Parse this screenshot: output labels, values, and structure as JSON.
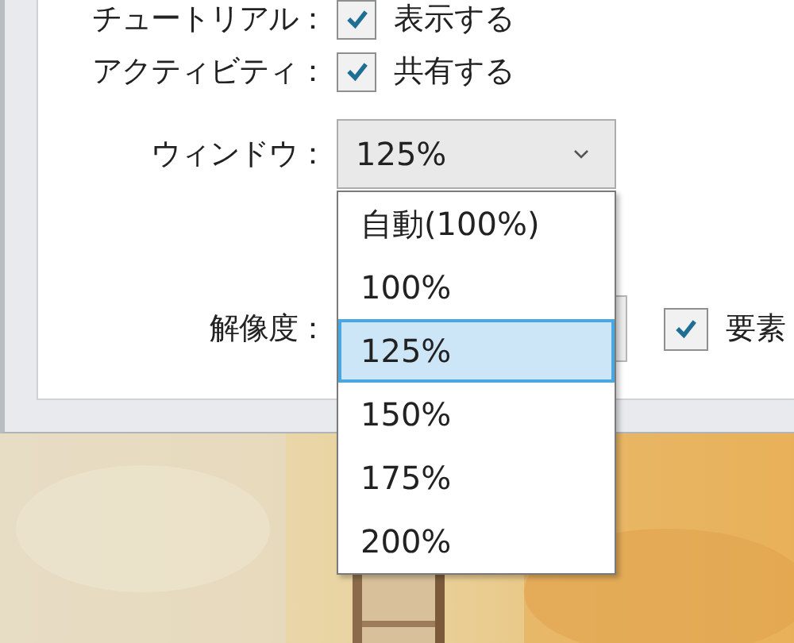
{
  "settings": [
    {
      "kind": "checkbox",
      "label": "チュートリアル：",
      "checked": true,
      "text": "表示する"
    },
    {
      "kind": "checkbox",
      "label": "アクティビティ：",
      "checked": true,
      "text": "共有する"
    },
    {
      "kind": "select",
      "label": "ウィンドウ：",
      "value": "125%",
      "open": true
    },
    {
      "kind": "select-checkbox",
      "label": "解像度：",
      "checked": true,
      "text": "要素"
    }
  ],
  "dropdown": {
    "options": [
      {
        "label": "自動(100%)",
        "selected": false
      },
      {
        "label": "100%",
        "selected": false
      },
      {
        "label": "125%",
        "selected": true
      },
      {
        "label": "150%",
        "selected": false
      },
      {
        "label": "175%",
        "selected": false
      },
      {
        "label": "200%",
        "selected": false
      }
    ]
  }
}
